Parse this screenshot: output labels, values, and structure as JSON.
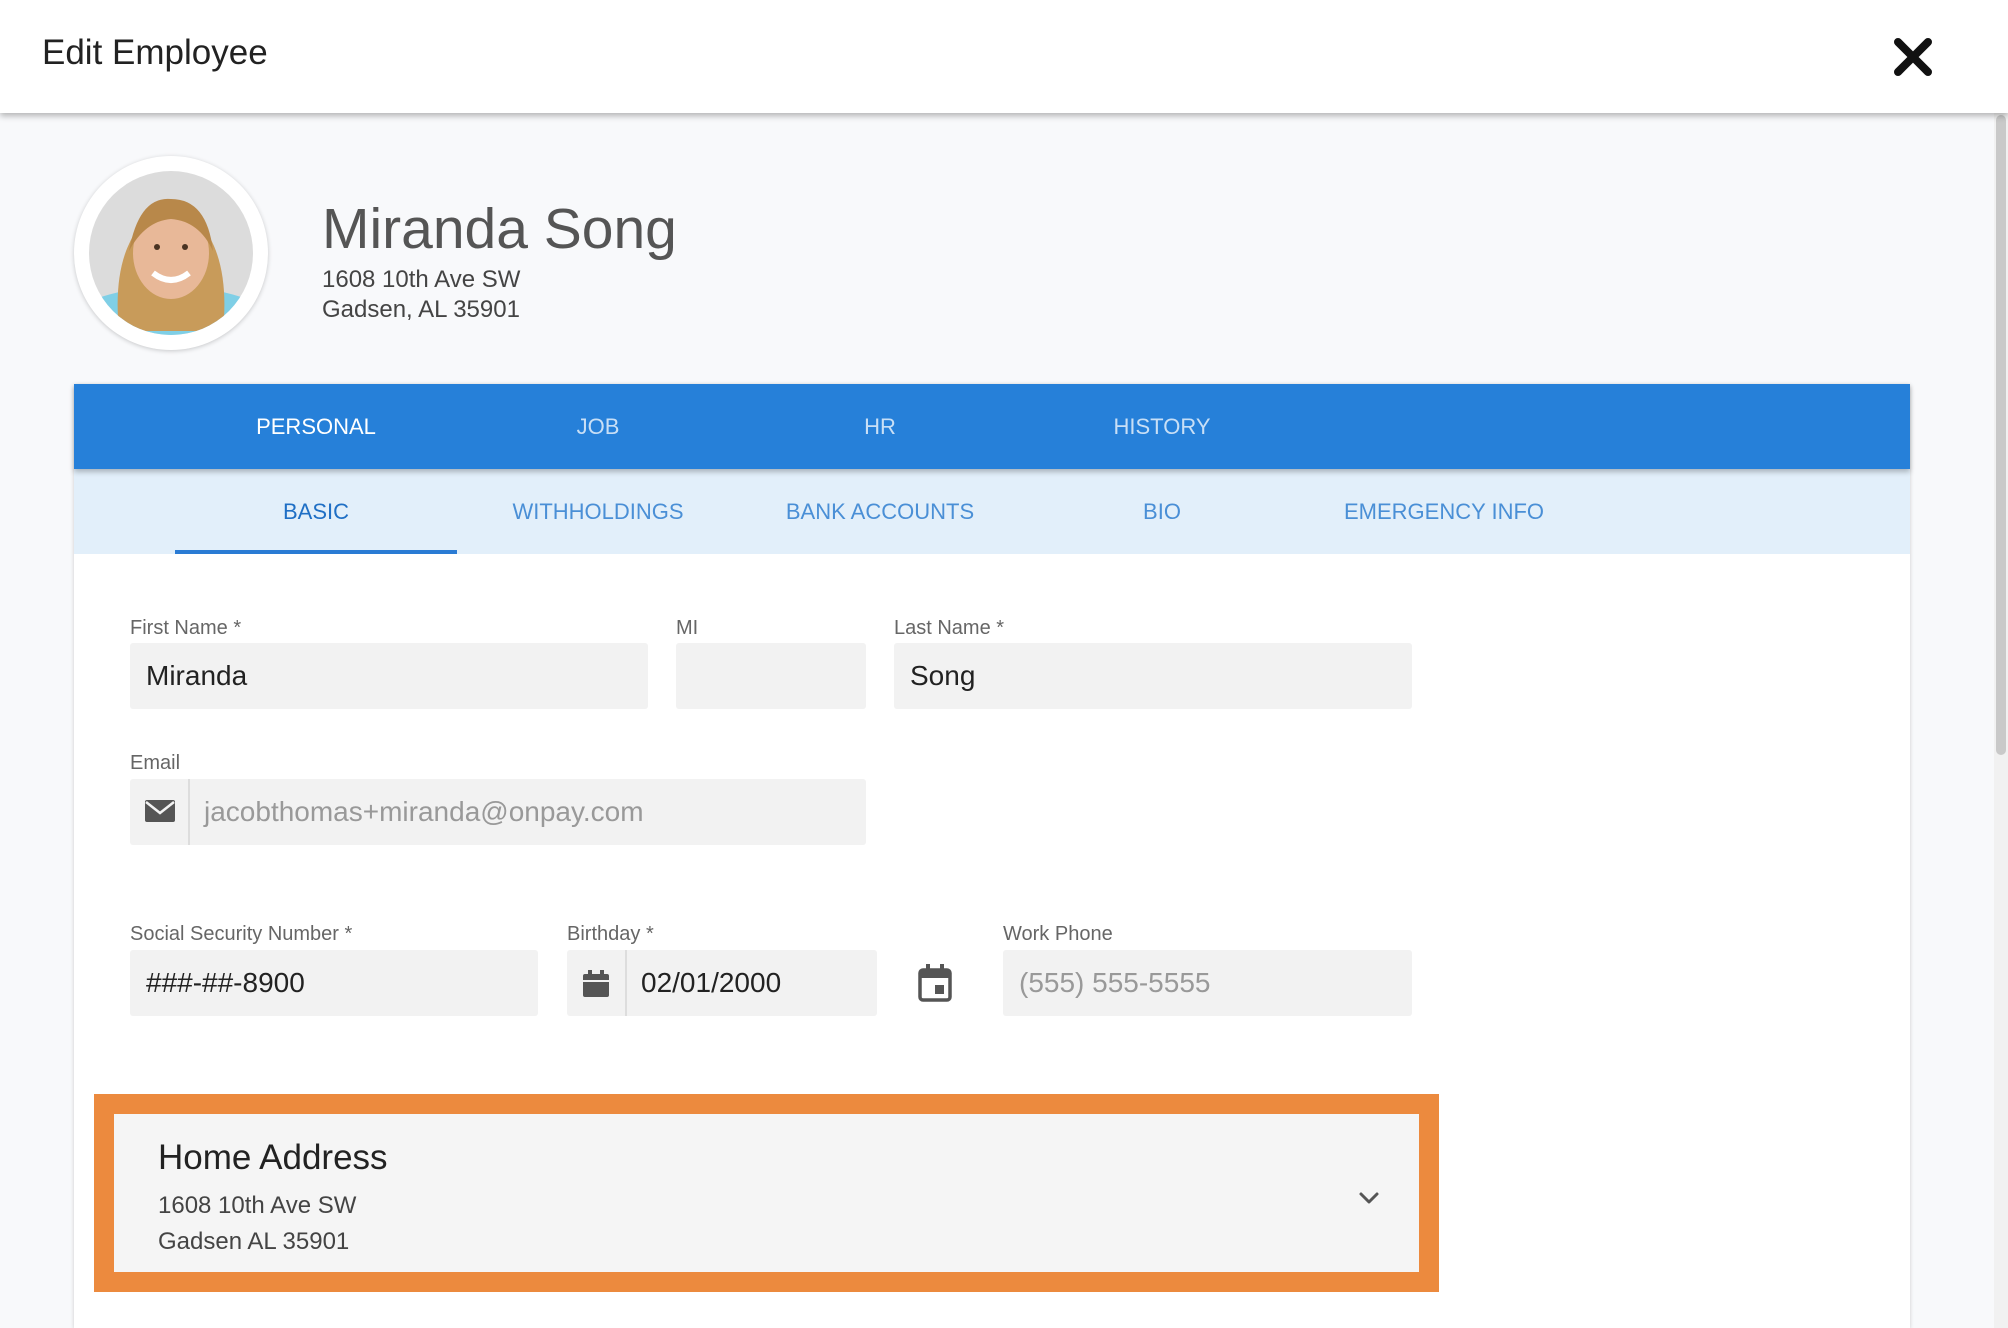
{
  "header": {
    "title": "Edit Employee"
  },
  "employee": {
    "name": "Miranda Song",
    "address_line1": "1608 10th Ave SW",
    "address_line2": "Gadsen, AL 35901"
  },
  "main_tabs": [
    {
      "label": "PERSONAL",
      "active": true
    },
    {
      "label": "JOB"
    },
    {
      "label": "HR"
    },
    {
      "label": "HISTORY"
    }
  ],
  "sub_tabs": [
    {
      "label": "BASIC",
      "active": true
    },
    {
      "label": "WITHHOLDINGS"
    },
    {
      "label": "BANK ACCOUNTS"
    },
    {
      "label": "BIO"
    },
    {
      "label": "EMERGENCY INFO"
    }
  ],
  "form": {
    "first_name": {
      "label": "First Name",
      "required": "*",
      "value": "Miranda"
    },
    "mi": {
      "label": "MI",
      "value": ""
    },
    "last_name": {
      "label": "Last Name",
      "required": "*",
      "value": "Song"
    },
    "email": {
      "label": "Email",
      "value": "jacobthomas+miranda@onpay.com"
    },
    "ssn": {
      "label": "Social Security Number",
      "required": "*",
      "value": "###-##-8900"
    },
    "birthday": {
      "label": "Birthday",
      "required": "*",
      "value": "02/01/2000"
    },
    "work_phone": {
      "label": "Work Phone",
      "placeholder": "(555) 555-5555"
    }
  },
  "home_address": {
    "title": "Home Address",
    "line1": "1608 10th Ave SW",
    "line2": "Gadsen AL 35901"
  },
  "colors": {
    "primary": "#2680d9",
    "subtab_bg": "#e2effa",
    "highlight": "#ec8a3e"
  }
}
